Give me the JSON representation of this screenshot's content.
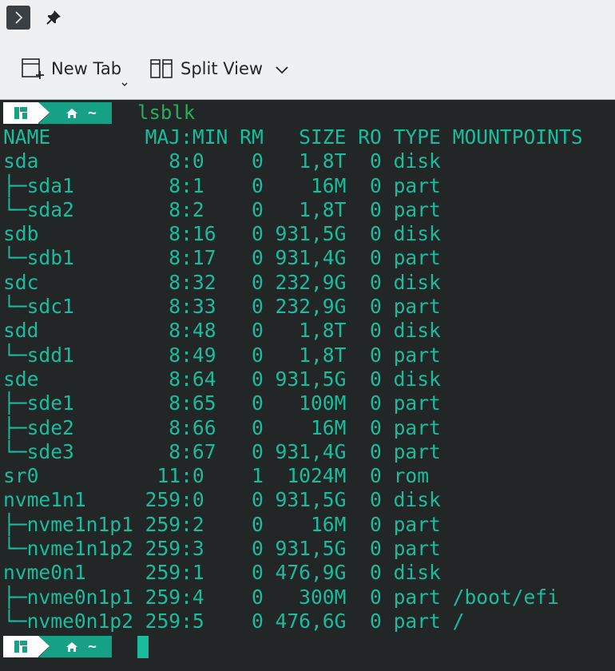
{
  "toolbar": {
    "new_tab_label": "New Tab",
    "split_view_label": "Split View"
  },
  "icons": {
    "terminal_menu": "chevron-right-icon",
    "pin": "pin-icon",
    "new_tab": "new-tab-icon",
    "split_view": "split-view-icon",
    "dropdown": "chevron-down-icon",
    "home": "home-icon",
    "logo": "manjaro-logo-icon"
  },
  "prompt": {
    "dir": "~",
    "command": "lsblk"
  },
  "output": {
    "header": "NAME        MAJ:MIN RM   SIZE RO TYPE MOUNTPOINTS",
    "lines": [
      "sda           8:0    0   1,8T  0 disk ",
      "├─sda1        8:1    0    16M  0 part ",
      "└─sda2        8:2    0   1,8T  0 part ",
      "sdb           8:16   0 931,5G  0 disk ",
      "└─sdb1        8:17   0 931,4G  0 part ",
      "sdc           8:32   0 232,9G  0 disk ",
      "└─sdc1        8:33   0 232,9G  0 part ",
      "sdd           8:48   0   1,8T  0 disk ",
      "└─sdd1        8:49   0   1,8T  0 part ",
      "sde           8:64   0 931,5G  0 disk ",
      "├─sde1        8:65   0   100M  0 part ",
      "├─sde2        8:66   0    16M  0 part ",
      "└─sde3        8:67   0 931,4G  0 part ",
      "sr0          11:0    1  1024M  0 rom  ",
      "nvme1n1     259:0    0 931,5G  0 disk ",
      "├─nvme1n1p1 259:2    0    16M  0 part ",
      "└─nvme1n1p2 259:3    0 931,5G  0 part ",
      "nvme0n1     259:1    0 476,9G  0 disk ",
      "├─nvme0n1p1 259:4    0   300M  0 part /boot/efi",
      "└─nvme0n1p2 259:5    0 476,6G  0 part /"
    ]
  },
  "colors": {
    "terminal_bg": "#232627",
    "output_text": "#1abc9c",
    "command_text": "#27ae60",
    "dir_segment": "#16a085"
  }
}
